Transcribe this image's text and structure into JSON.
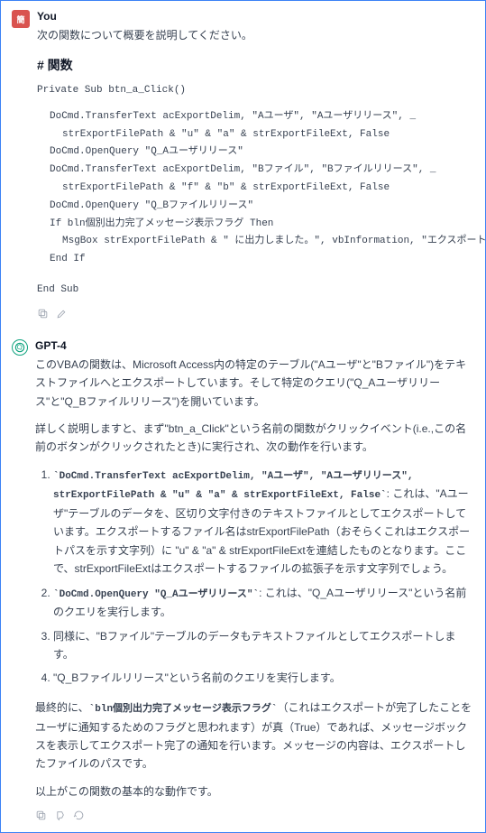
{
  "user": {
    "label": "You",
    "intro": "次の関数について概要を説明してください。",
    "heading": "# 関数",
    "sig": "Private Sub btn_a_Click()",
    "code": [
      "DoCmd.TransferText acExportDelim, \"Aユーザ\", \"Aユーザリリース\", _",
      "    strExportFilePath & \"u\" & \"a\" & strExportFileExt, False",
      "DoCmd.OpenQuery \"Q_Aユーザリリース\"",
      "DoCmd.TransferText acExportDelim, \"Bファイル\", \"Bファイルリリース\", _",
      "    strExportFilePath & \"f\" & \"b\" & strExportFileExt, False",
      "DoCmd.OpenQuery \"Q_Bファイルリリース\"",
      "",
      "If bln個別出力完了メッセージ表示フラグ Then",
      "    MsgBox strExportFilePath & \" に出力しました。\", vbInformation, \"エクスポート\"",
      "End If"
    ],
    "end": "End Sub"
  },
  "assistant": {
    "label": "GPT-4",
    "p1": "このVBAの関数は、Microsoft Access内の特定のテーブル(\"Aユーザ\"と\"Bファイル\")をテキストファイルへとエクスポートしています。そして特定のクエリ(\"Q_Aユーザリリース\"と\"Q_Bファイルリリース\")を開いています。",
    "p2": "詳しく説明しますと、まず\"btn_a_Click\"という名前の関数がクリックイベント(i.e.,この名前のボタンがクリックされたとき)に実行され、次の動作を行います。",
    "items": [
      {
        "code": "`DoCmd.TransferText acExportDelim, \"Aユーザ\", \"Aユーザリリース\", strExportFilePath & \"u\" & \"a\" & strExportFileExt, False`",
        "after": ": これは、\"Aユーザ\"テーブルのデータを、区切り文字付きのテキストファイルとしてエクスポートしています。エクスポートするファイル名はstrExportFilePath（おそらくこれはエクスポートパスを示す文字列）に \"u\" & \"a\" & strExportFileExtを連結したものとなります。ここで、strExportFileExtはエクスポートするファイルの拡張子を示す文字列でしょう。"
      },
      {
        "code": "`DoCmd.OpenQuery \"Q_Aユーザリリース\"`",
        "after": ": これは、\"Q_Aユーザリリース\"という名前のクエリを実行します。"
      },
      {
        "plain": "同様に、\"Bファイル\"テーブルのデータもテキストファイルとしてエクスポートします。"
      },
      {
        "plain": "\"Q_Bファイルリリース\"という名前のクエリを実行します。"
      }
    ],
    "p3a": "最終的に、",
    "p3code": "`bln個別出力完了メッセージ表示フラグ`",
    "p3b": "（これはエクスポートが完了したことをユーザに通知するためのフラグと思われます）が真（True）であれば、メッセージボックスを表示してエクスポート完了の通知を行います。メッセージの内容は、エクスポートしたファイルのパスです。",
    "p4": "以上がこの関数の基本的な動作です。"
  }
}
